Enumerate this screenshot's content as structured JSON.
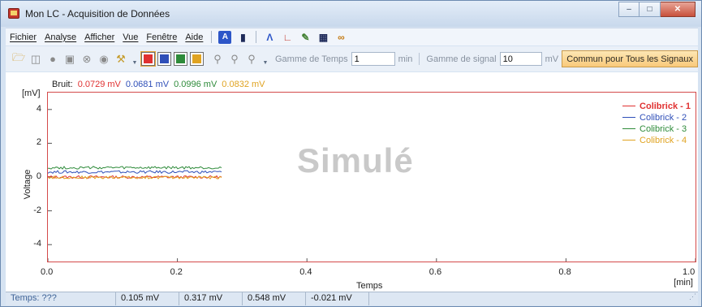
{
  "window": {
    "title": "Mon LC - Acquisition de Données",
    "minimize": "–",
    "maximize": "□",
    "close": "✕"
  },
  "menu": {
    "items": [
      "Fichier",
      "Analyse",
      "Afficher",
      "Vue",
      "Fenêtre",
      "Aide"
    ],
    "icons": [
      "acquisition-a-icon",
      "signal-icon",
      "peaks-icon",
      "chart-line-icon",
      "edit-icon",
      "table-icon",
      "glasses-icon"
    ]
  },
  "toolbar": {
    "icons": [
      "open-folder-icon",
      "save-icon",
      "record-icon",
      "camera-icon",
      "stop-icon",
      "settings-disabled-icon",
      "wrench-icon"
    ],
    "channel_colors": [
      "#e03131",
      "#2f4fb8",
      "#2e8b3a",
      "#e0a321"
    ],
    "zoom_icons": [
      "zoom-in-icon",
      "zoom-out-icon",
      "zoom-fit-icon"
    ],
    "time_range_label": "Gamme de Temps",
    "time_range_value": "1",
    "time_unit": "min",
    "signal_range_label": "Gamme de signal",
    "signal_range_value": "10",
    "signal_unit": "mV",
    "common_button": "Commun pour Tous les Signaux"
  },
  "panel": {
    "noise_label": "Bruit:",
    "noise_values": [
      "0.0729 mV",
      "0.0681 mV",
      "0.0996 mV",
      "0.0832 mV"
    ],
    "y_unit": "[mV]",
    "y_label": "Voltage",
    "x_label": "Temps",
    "x_unit": "[min]",
    "watermark": "Simulé"
  },
  "chart_data": {
    "type": "line",
    "xlabel": "Temps",
    "ylabel": "Voltage",
    "xlim": [
      0.0,
      1.0
    ],
    "ylim": [
      -5,
      5
    ],
    "x_ticks": [
      "0.0",
      "0.2",
      "0.4",
      "0.6",
      "0.8",
      "1.0"
    ],
    "y_ticks": [
      "4",
      "2",
      "0",
      "-2",
      "-4"
    ],
    "legend_position": "top-right",
    "series": [
      {
        "name": "Colibrick - 1",
        "color": "#e03131",
        "x": [
          0.0,
          0.27
        ],
        "y": [
          0.0,
          0.0
        ]
      },
      {
        "name": "Colibrick - 2",
        "color": "#2f4fb8",
        "x": [
          0.0,
          0.27
        ],
        "y": [
          0.3,
          0.3
        ]
      },
      {
        "name": "Colibrick - 3",
        "color": "#2e8b3a",
        "x": [
          0.0,
          0.27
        ],
        "y": [
          0.55,
          0.55
        ]
      },
      {
        "name": "Colibrick - 4",
        "color": "#e0a321",
        "x": [
          0.0,
          0.27
        ],
        "y": [
          -0.02,
          -0.02
        ]
      }
    ]
  },
  "status": {
    "time": "Temps: ???",
    "values": [
      "0.105 mV",
      "0.317 mV",
      "0.548 mV",
      "-0.021 mV"
    ]
  }
}
